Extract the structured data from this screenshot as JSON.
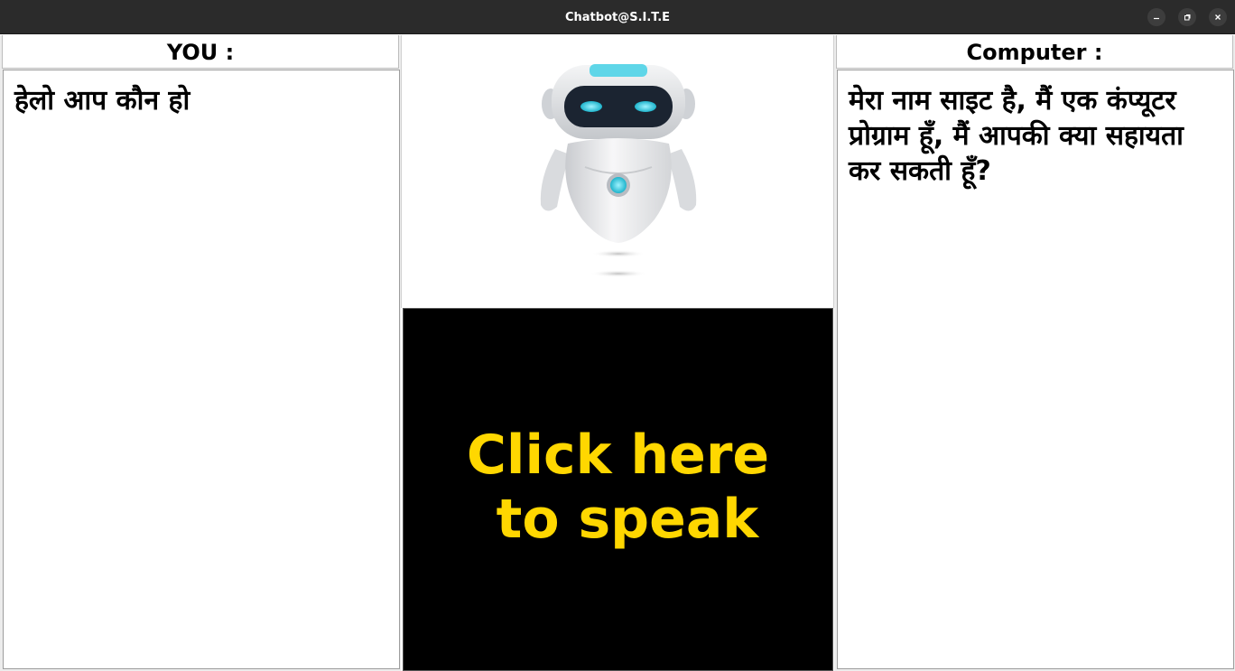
{
  "window": {
    "title": "Chatbot@S.I.T.E",
    "controls": [
      {
        "name": "minimize",
        "icon": "minimize-icon"
      },
      {
        "name": "maximize",
        "icon": "maximize-icon"
      },
      {
        "name": "close",
        "icon": "close-icon"
      }
    ]
  },
  "user_panel": {
    "header": "YOU :",
    "text": "हेलो आप कौन हो"
  },
  "bot_panel": {
    "header": "Computer :",
    "text": "मेरा नाम साइट है, मैं एक कंप्यूटर प्रोग्राम हूँ,  मैं आपकी क्या सहायता कर सकती हूँ?"
  },
  "center": {
    "robot_image": "robot-icon",
    "speak_button_label": "Click here\n to speak"
  },
  "colors": {
    "titlebar": "#2b2b2b",
    "speak_button_bg": "#000000",
    "speak_button_text": "#ffd700"
  }
}
